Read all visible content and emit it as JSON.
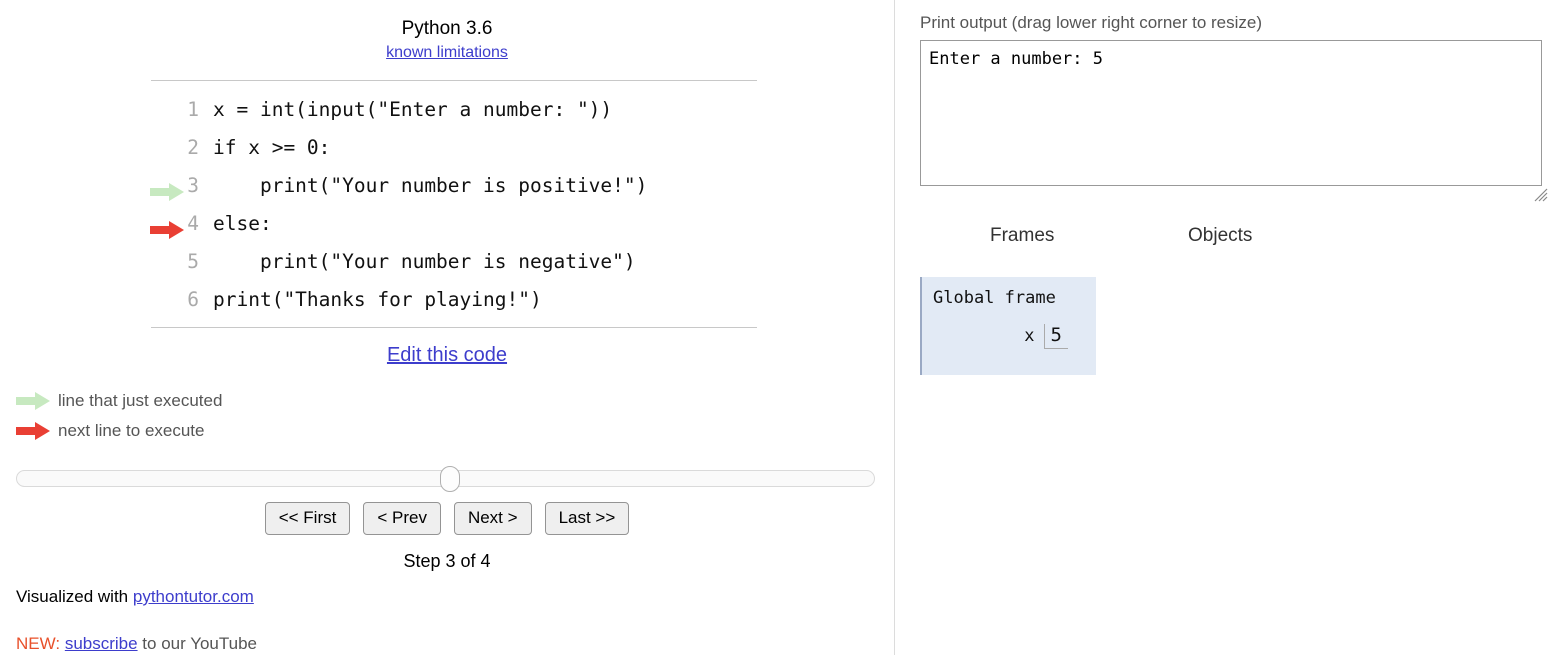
{
  "left": {
    "python_version": "Python 3.6",
    "known_limitations_link": "known limitations",
    "code_lines": [
      {
        "num": "1",
        "text": "x = int(input(\"Enter a number: \"))",
        "marker": "none"
      },
      {
        "num": "2",
        "text": "if x >= 0:",
        "marker": "green"
      },
      {
        "num": "3",
        "text": "    print(\"Your number is positive!\")",
        "marker": "red"
      },
      {
        "num": "4",
        "text": "else:",
        "marker": "none"
      },
      {
        "num": "5",
        "text": "    print(\"Your number is negative\")",
        "marker": "none"
      },
      {
        "num": "6",
        "text": "print(\"Thanks for playing!\")",
        "marker": "none"
      }
    ],
    "edit_code_link": "Edit this code",
    "legend": {
      "just_executed": "line that just executed",
      "next_line": "next line to execute"
    },
    "slider": {
      "value": 3,
      "min": 1,
      "max": 4,
      "position_percent": 50
    },
    "nav_buttons": {
      "first": "<< First",
      "prev": "< Prev",
      "next": "Next >",
      "last": "Last >>"
    },
    "step_label": "Step 3 of 4",
    "footer": {
      "visualized_prefix": "Visualized with ",
      "visualized_link": "pythontutor.com",
      "promo_new": "NEW:",
      "promo_link": "subscribe",
      "promo_tail": " to our YouTube"
    }
  },
  "right": {
    "print_output_label": "Print output (drag lower right corner to resize)",
    "print_output_value": "Enter a number: 5",
    "frames_header": "Frames",
    "objects_header": "Objects",
    "frames": [
      {
        "title": "Global frame",
        "vars": [
          {
            "name": "x",
            "value": "5"
          }
        ]
      }
    ]
  },
  "colors": {
    "green_arrow": "#c7e9c0",
    "red_arrow": "#e93f34",
    "link": "#3d3dcc",
    "frame_bg": "#e2eaf5",
    "frame_border": "#9aa9c4",
    "promo_new": "#e8502a"
  }
}
